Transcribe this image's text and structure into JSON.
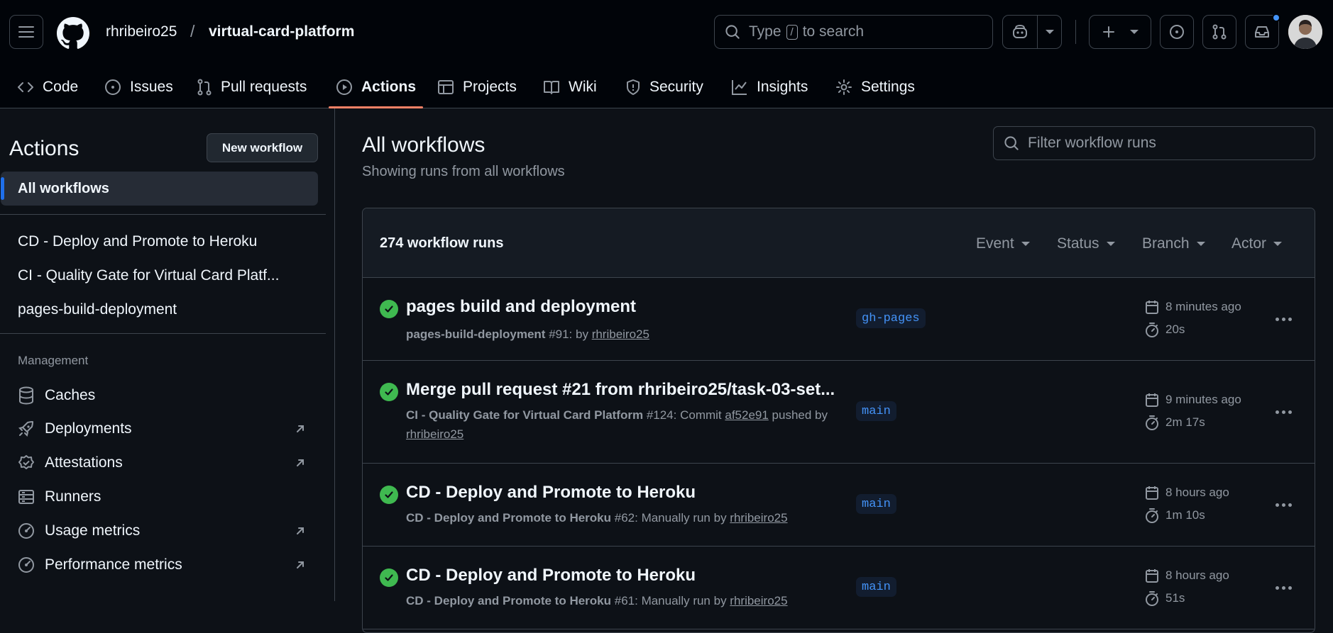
{
  "header": {
    "owner": "rhribeiro25",
    "separator": "/",
    "repo": "virtual-card-platform",
    "search_before": "Type",
    "search_key": "/",
    "search_after": "to search"
  },
  "tabs": [
    {
      "label": "Code"
    },
    {
      "label": "Issues"
    },
    {
      "label": "Pull requests"
    },
    {
      "label": "Actions"
    },
    {
      "label": "Projects"
    },
    {
      "label": "Wiki"
    },
    {
      "label": "Security"
    },
    {
      "label": "Insights"
    },
    {
      "label": "Settings"
    }
  ],
  "sidebar": {
    "title": "Actions",
    "new_workflow": "New workflow",
    "all_workflows": "All workflows",
    "workflows": [
      "CD - Deploy and Promote to Heroku",
      "CI - Quality Gate for Virtual Card Platf...",
      "pages-build-deployment"
    ],
    "management_label": "Management",
    "management": [
      {
        "label": "Caches"
      },
      {
        "label": "Deployments"
      },
      {
        "label": "Attestations"
      },
      {
        "label": "Runners"
      },
      {
        "label": "Usage metrics"
      },
      {
        "label": "Performance metrics"
      }
    ]
  },
  "main": {
    "title": "All workflows",
    "subtitle": "Showing runs from all workflows",
    "filter_placeholder": "Filter workflow runs",
    "runs_count": "274 workflow runs",
    "filters": [
      "Event",
      "Status",
      "Branch",
      "Actor"
    ],
    "runs": [
      {
        "title": "pages build and deployment",
        "workflow": "pages-build-deployment",
        "detail": " #91: by ",
        "user": "rhribeiro25",
        "branch": "gh-pages",
        "when": "8 minutes ago",
        "duration": "20s"
      },
      {
        "title": "Merge pull request #21 from rhribeiro25/task-03-set...",
        "workflow": "CI - Quality Gate for Virtual Card Platform",
        "detail": " #124: Commit ",
        "commit": "af52e91",
        "detail2": " pushed by ",
        "user": "rhribeiro25",
        "branch": "main",
        "when": "9 minutes ago",
        "duration": "2m 17s"
      },
      {
        "title": "CD - Deploy and Promote to Heroku",
        "workflow": "CD - Deploy and Promote to Heroku",
        "detail": " #62: Manually run by ",
        "user": "rhribeiro25",
        "branch": "main",
        "when": "8 hours ago",
        "duration": "1m 10s"
      },
      {
        "title": "CD - Deploy and Promote to Heroku",
        "workflow": "CD - Deploy and Promote to Heroku",
        "detail": " #61: Manually run by ",
        "user": "rhribeiro25",
        "branch": "main",
        "when": "8 hours ago",
        "duration": "51s"
      }
    ]
  },
  "colors": {
    "accent": "#f78166",
    "success": "#3fb950",
    "link": "#4493f8",
    "background": "#0d1117"
  }
}
